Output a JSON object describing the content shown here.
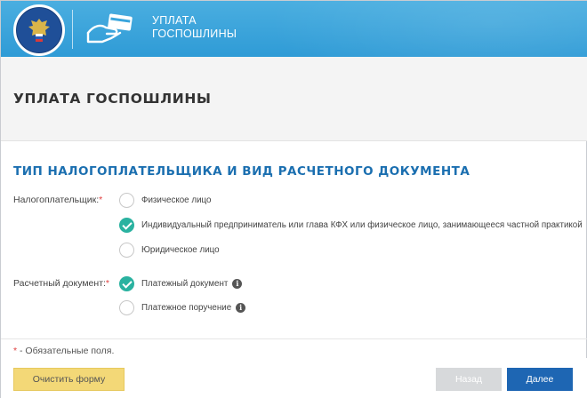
{
  "header": {
    "service_title_line1": "УПЛАТА",
    "service_title_line2": "ГОСПОШЛИНЫ",
    "emblem_icon": "fns-emblem-icon",
    "service_icon": "hand-card-payment-icon"
  },
  "page": {
    "title": "УПЛАТА ГОСПОШЛИНЫ"
  },
  "section": {
    "title": "ТИП НАЛОГОПЛАТЕЛЬЩИКА И ВИД РАСЧЕТНОГО ДОКУМЕНТА"
  },
  "taxpayer": {
    "label": "Налогоплательщик:",
    "required_mark": "*",
    "options": [
      {
        "label": "Физическое лицо",
        "selected": false
      },
      {
        "label": "Индивидуальный предприниматель или глава КФХ или физическое лицо, занимающееся частной практикой",
        "selected": true
      },
      {
        "label": "Юридическое лицо",
        "selected": false
      }
    ]
  },
  "document": {
    "label": "Расчетный документ:",
    "required_mark": "*",
    "options": [
      {
        "label": "Платежный документ",
        "selected": true,
        "info": "i"
      },
      {
        "label": "Платежное поручение",
        "selected": false,
        "info": "i"
      }
    ]
  },
  "footnote": {
    "mark": "*",
    "text": " - Обязательные поля."
  },
  "buttons": {
    "clear": "Очистить форму",
    "back": "Назад",
    "next": "Далее"
  },
  "colors": {
    "header_blue": "#3aa5dc",
    "accent_teal": "#2ab2a0",
    "title_blue": "#1b6fb0",
    "primary_button": "#1e66b3",
    "clear_button": "#f3d877",
    "disabled_button": "#d7d9db",
    "required_red": "#e04040"
  }
}
